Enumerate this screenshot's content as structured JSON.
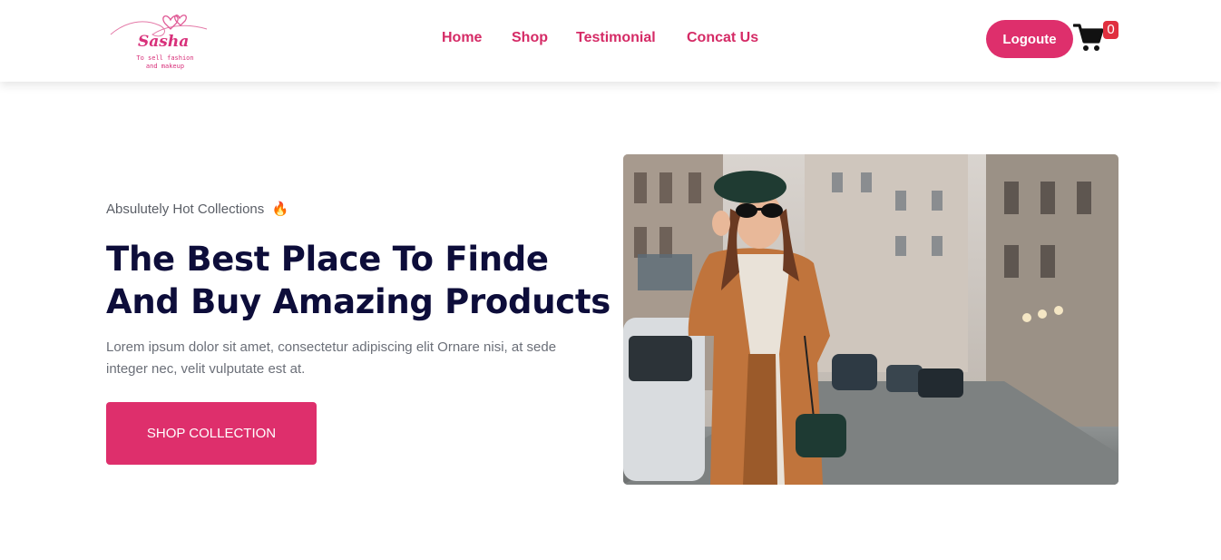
{
  "brand": {
    "name": "Sasha",
    "tagline": "To sell fashion and makeup",
    "logo_icon": "heart-icon",
    "accent_color": "#de2f6c"
  },
  "nav": {
    "items": [
      {
        "label": "Home"
      },
      {
        "label": "Shop"
      },
      {
        "label": "Testimonial"
      },
      {
        "label": "Concat Us"
      }
    ]
  },
  "header": {
    "logout_label": "Logoute",
    "cart_icon": "cart-icon",
    "cart_count": "0"
  },
  "hero": {
    "eyebrow": "Absulutely Hot Collections",
    "eyebrow_emoji": "🔥",
    "title": "The Best Place To Finde And Buy Amazing Products",
    "text": "Lorem ipsum dolor sit amet, consectetur adipiscing elit Ornare nisi, at sede integer nec, velit vulputate est at.",
    "cta_label": "SHOP COLLECTION"
  },
  "colors": {
    "primary": "#de2f6c",
    "heading": "#0d0d3a",
    "body_text": "#6b6f78",
    "badge": "#e0303f"
  }
}
